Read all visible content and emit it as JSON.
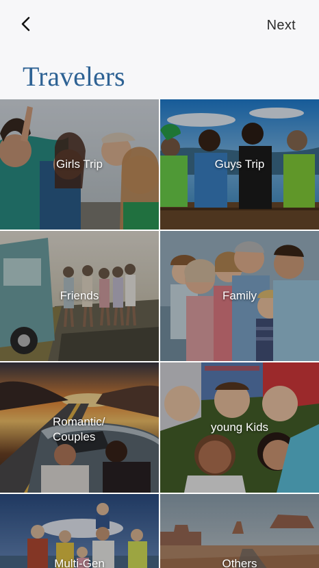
{
  "header": {
    "back_icon": "chevron-left-icon",
    "next_label": "Next"
  },
  "page": {
    "title": "Travelers"
  },
  "colors": {
    "title": "#2e6294",
    "background": "#f7f7f9",
    "tile_label": "#ffffff"
  },
  "tiles": [
    {
      "label": "Girls Trip"
    },
    {
      "label": "Guys Trip"
    },
    {
      "label": "Friends"
    },
    {
      "label": "Family"
    },
    {
      "label": "Romantic/ Couples"
    },
    {
      "label": "young Kids"
    },
    {
      "label": "Multi-Gen"
    },
    {
      "label": "Others"
    }
  ]
}
